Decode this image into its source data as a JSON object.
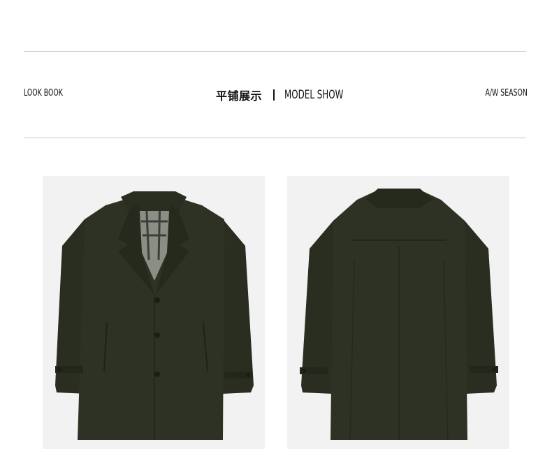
{
  "header": {
    "left_label": "LOOK BOOK",
    "title_cn": "平铺展示",
    "title_en": "MODEL SHOW",
    "right_label": "A/W SEASON"
  },
  "photos": [
    {
      "view": "front",
      "subject": "dark olive wool coat, front"
    },
    {
      "view": "back",
      "subject": "dark olive wool coat, back"
    }
  ],
  "colors": {
    "coat": "#2e3224",
    "coat_shadow": "#23271b",
    "photo_bg": "#f2f2f2",
    "rule": "#c9c9c9"
  }
}
